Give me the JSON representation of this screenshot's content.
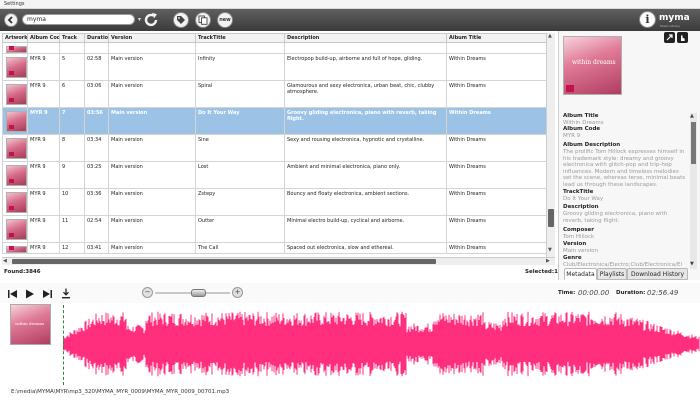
{
  "window": {
    "title": "Settings"
  },
  "toolbar": {
    "search_value": "myma",
    "new_label": "new",
    "brand_text": "myma",
    "brand_tagline": "Music Library"
  },
  "grid": {
    "columns": [
      "Artwork",
      "Album Code",
      "Track",
      "Duration",
      "Version",
      "TrackTitle",
      "Description",
      "Album Title"
    ],
    "rows": [
      {
        "album_code": "",
        "track": "",
        "duration": "",
        "version": "",
        "title": "",
        "description": "",
        "album_title": "",
        "partial": true
      },
      {
        "album_code": "MYR 9",
        "track": "5",
        "duration": "02:58",
        "version": "Main version",
        "title": "Infinity",
        "description": "Electropop build-up, airborne and full of hope, gliding.",
        "album_title": "Within Dreams"
      },
      {
        "album_code": "MYR 9",
        "track": "6",
        "duration": "03:06",
        "version": "Main version",
        "title": "Spiral",
        "description": "Glamourous and sexy electronica, urban beat, chic, clubby atmosphere.",
        "album_title": "Within Dreams"
      },
      {
        "album_code": "MYR 9",
        "track": "7",
        "duration": "03:56",
        "version": "Main version",
        "title": "Do It Your Way",
        "description": "Groovy gliding electronica, piano with reverb, taking flight.",
        "album_title": "Within Dreams",
        "selected": true
      },
      {
        "album_code": "MYR 9",
        "track": "8",
        "duration": "03:34",
        "version": "Main version",
        "title": "Sine",
        "description": "Sexy and rousing electronica, hypnotic and crystalline.",
        "album_title": "Within Dreams"
      },
      {
        "album_code": "MYR 9",
        "track": "9",
        "duration": "03:25",
        "version": "Main version",
        "title": "Lost",
        "description": "Ambient and minimal electronica, piano only.",
        "album_title": "Within Dreams"
      },
      {
        "album_code": "MYR 9",
        "track": "10",
        "duration": "03:36",
        "version": "Main version",
        "title": "Zstepy",
        "description": "Bouncy and floaty electronica, ambient sections.",
        "album_title": "Within Dreams"
      },
      {
        "album_code": "MYR 9",
        "track": "11",
        "duration": "02:54",
        "version": "Main version",
        "title": "Outter",
        "description": "Minimal electro build-up, cyclical and airborne.",
        "album_title": "Within Dreams"
      },
      {
        "album_code": "MYR 9",
        "track": "12",
        "duration": "03:41",
        "version": "Main version",
        "title": "The Call",
        "description": "Spaced out electronica, slow and ethereal.",
        "album_title": "Within Dreams",
        "partial": true
      }
    ]
  },
  "status": {
    "found": "Found:3846",
    "selected": "Selected:1"
  },
  "metadata": {
    "album_art_text": "within dreams",
    "fields": [
      {
        "label": "Album Title",
        "value": "Within Dreams"
      },
      {
        "label": "Album Code",
        "value": "MYR 9"
      },
      {
        "label": "Album Description",
        "value": "The prolific Tom Hillock expresses himself in his trademark style: dreamy and groovy electronica with glitch-pop and trip-hop influences. Modern and timeless melodies set the scene, whereas terse, minimal beats lead us through these landscapes."
      },
      {
        "label": "TrackTitle",
        "value": "Do It Your Way"
      },
      {
        "label": "Description",
        "value": "Groovy gliding electronica, piano with reverb, taking flight."
      },
      {
        "label": "Composer",
        "value": "Tom Hillock"
      },
      {
        "label": "Version",
        "value": "Main version"
      },
      {
        "label": "Genre",
        "value": "Club/Electronica/Electro;Club/Electronica/El"
      }
    ]
  },
  "tabs": [
    "Metadata",
    "Playlists",
    "Download History"
  ],
  "player": {
    "time_label": "Time:",
    "time_value": "00:00.00",
    "duration_label": "Duration:",
    "duration_value": "02:56.49",
    "volume": 0.6,
    "art_text": "within dreams",
    "waveform_color": "#ff2f7d"
  },
  "file_path": "E:\\media\\MYMA\\MYR\\mp3_320\\MYMA_MYR_0009\\MYMA_MYR_0009_00701.mp3"
}
